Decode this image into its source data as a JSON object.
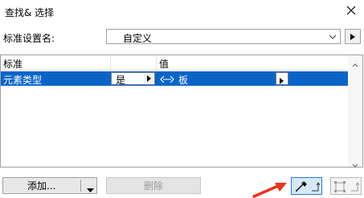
{
  "window": {
    "title": "查找& 选择"
  },
  "criteria": {
    "label": "标准设置名:",
    "selected": "自定义"
  },
  "grid": {
    "columns": [
      "标准",
      "值"
    ],
    "rows": [
      {
        "criterion": "元素类型",
        "operator": "是",
        "value": "板"
      }
    ]
  },
  "buttons": {
    "add": "添加...",
    "delete": "删除"
  },
  "colors": {
    "selection": "#0a64c8",
    "annotation_arrow": "#e8341c",
    "tool_active_border": "#2b7bd6"
  },
  "icons": {
    "close": "close-icon",
    "dropdown": "chevron-down-icon",
    "side": "triangle-right-icon",
    "pick": "eyedropper-icon",
    "apply": "marquee-icon"
  }
}
